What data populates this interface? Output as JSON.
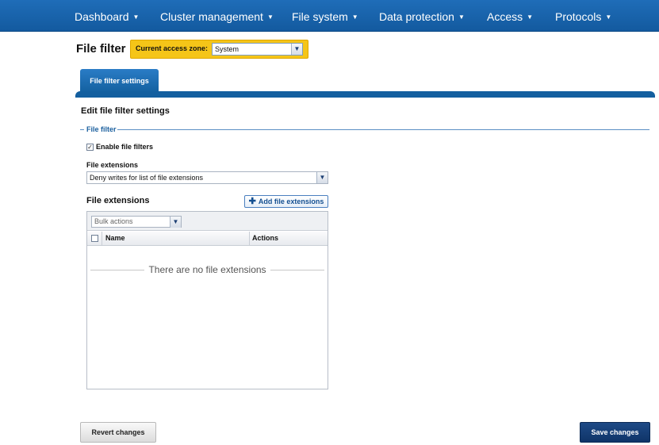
{
  "nav": {
    "items": [
      {
        "label": "Dashboard"
      },
      {
        "label": "Cluster management"
      },
      {
        "label": "File system"
      },
      {
        "label": "Data protection"
      },
      {
        "label": "Access"
      },
      {
        "label": "Protocols"
      }
    ],
    "caret_icon": "caret-down-icon"
  },
  "header": {
    "title": "File filter",
    "zone_label": "Current access zone:",
    "zone_value": "System"
  },
  "tabs": [
    {
      "label": "File filter settings",
      "active": true
    }
  ],
  "section": {
    "title": "Edit file filter settings",
    "legend": "File filter",
    "enable_label": "Enable file filters",
    "enable_checked": true,
    "extensions_field_label": "File extensions",
    "extensions_mode_value": "Deny writes for list of file extensions"
  },
  "extensions_table": {
    "heading": "File extensions",
    "add_button_label": "Add file extensions",
    "bulk_placeholder": "Bulk actions",
    "columns": [
      "Name",
      "Actions"
    ],
    "rows": [],
    "empty_text": "There are no file extensions"
  },
  "footer": {
    "revert_label": "Revert changes",
    "save_label": "Save changes"
  },
  "colors": {
    "nav_bar": "#1a64ad",
    "zone_highlight": "#f5c518",
    "primary_button": "#17407a"
  }
}
